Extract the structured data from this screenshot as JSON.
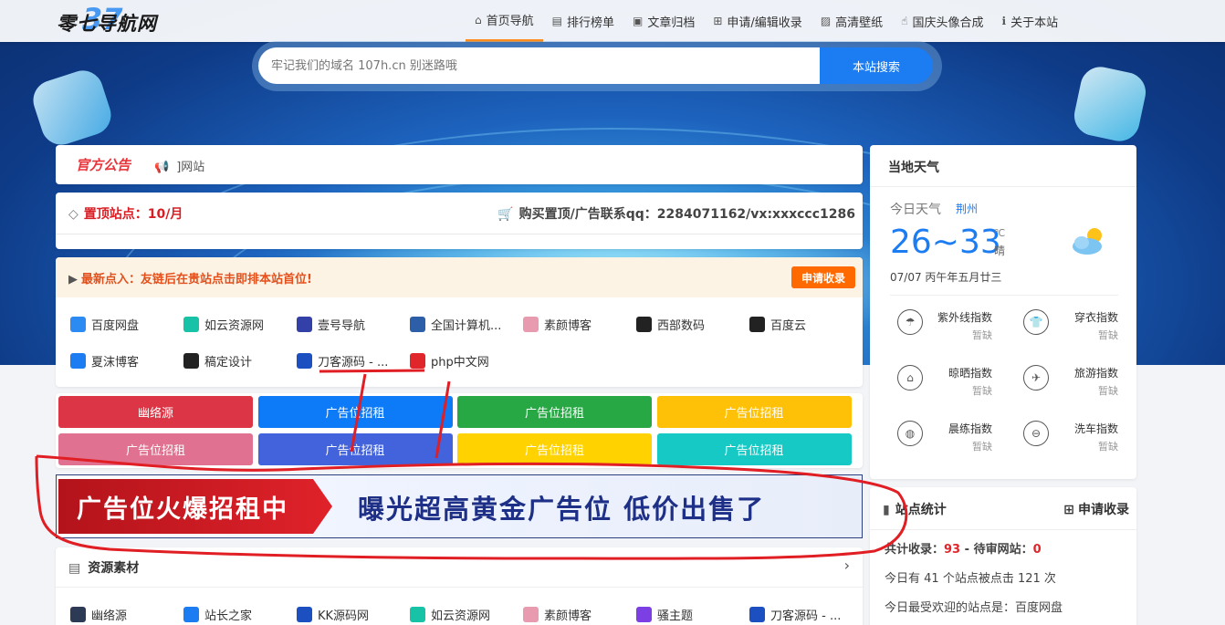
{
  "header": {
    "logo_text": "零七导航网",
    "logo_num": "37",
    "nav": [
      {
        "icon": "home-icon",
        "glyph": "⌂",
        "label": "首页导航",
        "active": true
      },
      {
        "icon": "ranking-icon",
        "glyph": "▤",
        "label": "排行榜单"
      },
      {
        "icon": "archive-icon",
        "glyph": "▣",
        "label": "文章归档"
      },
      {
        "icon": "plus-square-icon",
        "glyph": "⊞",
        "label": "申请/编辑收录"
      },
      {
        "icon": "image-icon",
        "glyph": "▨",
        "label": "高清壁纸"
      },
      {
        "icon": "hand-icon",
        "glyph": "☝",
        "label": "国庆头像合成"
      },
      {
        "icon": "info-icon",
        "glyph": "ℹ",
        "label": "关于本站"
      }
    ]
  },
  "search": {
    "placeholder": "牢记我们的域名 107h.cn 别迷路哦",
    "button": "本站搜索"
  },
  "notice": {
    "tag": "官方公告",
    "text": "]网站"
  },
  "top": {
    "label": "置顶站点：10/月",
    "contact": "购买置顶/广告联系qq：2284071162/vx:xxxccc1286"
  },
  "latest": {
    "hint": "最新点入：友链后在贵站点击即排本站首位!",
    "apply": "申请收录",
    "sites": [
      {
        "name": "百度网盘",
        "color": "#2b8bf2"
      },
      {
        "name": "如云资源网",
        "color": "#17c2a6"
      },
      {
        "name": "壹号导航",
        "color": "#3340a8"
      },
      {
        "name": "全国计算机...",
        "color": "#2d5fa8"
      },
      {
        "name": "素颜博客",
        "color": "#e89aae"
      },
      {
        "name": "西部数码",
        "color": "#222222"
      },
      {
        "name": "百度云",
        "color": "#222222"
      },
      {
        "name": "夏沫博客",
        "color": "#1c7cf2"
      },
      {
        "name": "稿定设计",
        "color": "#222222"
      },
      {
        "name": "刀客源码 - ...",
        "color": "#1c4fbf"
      },
      {
        "name": "php中文网",
        "color": "#e0262b"
      }
    ]
  },
  "ads": [
    {
      "label": "幽络源",
      "color": "#dc3545"
    },
    {
      "label": "广告位招租",
      "color": "#0d7bf7"
    },
    {
      "label": "广告位招租",
      "color": "#28a745"
    },
    {
      "label": "广告位招租",
      "color": "#ffc107"
    },
    {
      "label": "广告位招租",
      "color": "#e07190"
    },
    {
      "label": "广告位招租",
      "color": "#4263db"
    },
    {
      "label": "广告位招租",
      "color": "#ffd200"
    },
    {
      "label": "广告位招租",
      "color": "#17c9c4"
    }
  ],
  "banner": {
    "left": "广告位火爆招租中",
    "right": "曝光超高黄金广告位 低价出售了"
  },
  "resources": {
    "title": "资源素材",
    "sites": [
      {
        "name": "幽络源",
        "color": "#2d3a55"
      },
      {
        "name": "站长之家",
        "color": "#1c7cf2"
      },
      {
        "name": "KK源码网",
        "color": "#1c4fbf"
      },
      {
        "name": "如云资源网",
        "color": "#17c2a6"
      },
      {
        "name": "素颜博客",
        "color": "#e89aae"
      },
      {
        "name": "骚主题",
        "color": "#7b3fe4"
      },
      {
        "name": "刀客源码 - ...",
        "color": "#1c4fbf"
      }
    ]
  },
  "weather": {
    "title": "当地天气",
    "today": "今日天气",
    "city": "荆州",
    "temp": "26~33",
    "unit": "℃",
    "cond": "晴",
    "date": "07/07 丙午年五月廿三",
    "indices": [
      {
        "icon": "umbrella-icon",
        "glyph": "☂",
        "name": "紫外线指数",
        "value": "暂缺"
      },
      {
        "icon": "shirt-icon",
        "glyph": "👕",
        "name": "穿衣指数",
        "value": "暂缺"
      },
      {
        "icon": "hanger-icon",
        "glyph": "⌂",
        "name": "晾晒指数",
        "value": "暂缺"
      },
      {
        "icon": "plane-icon",
        "glyph": "✈",
        "name": "旅游指数",
        "value": "暂缺"
      },
      {
        "icon": "ball-icon",
        "glyph": "◍",
        "name": "晨练指数",
        "value": "暂缺"
      },
      {
        "icon": "car-icon",
        "glyph": "⊖",
        "name": "洗车指数",
        "value": "暂缺"
      }
    ]
  },
  "stats": {
    "title": "站点统计",
    "add": "申请收录",
    "total_label": "共计收录：",
    "total": "93",
    "sep": " - ",
    "pending_label": "待审网站：",
    "pending": "0",
    "today_pre": "今日有 ",
    "today_sites": "41",
    "today_mid": " 个站点被点击 ",
    "today_clicks": "121",
    "today_post": " 次",
    "popular_label": "今日最受欢迎的站点是：",
    "popular": "百度网盘"
  },
  "colors": {
    "accent": "#1c7cf2",
    "orange": "#ff6a00",
    "red": "#e0262b"
  }
}
